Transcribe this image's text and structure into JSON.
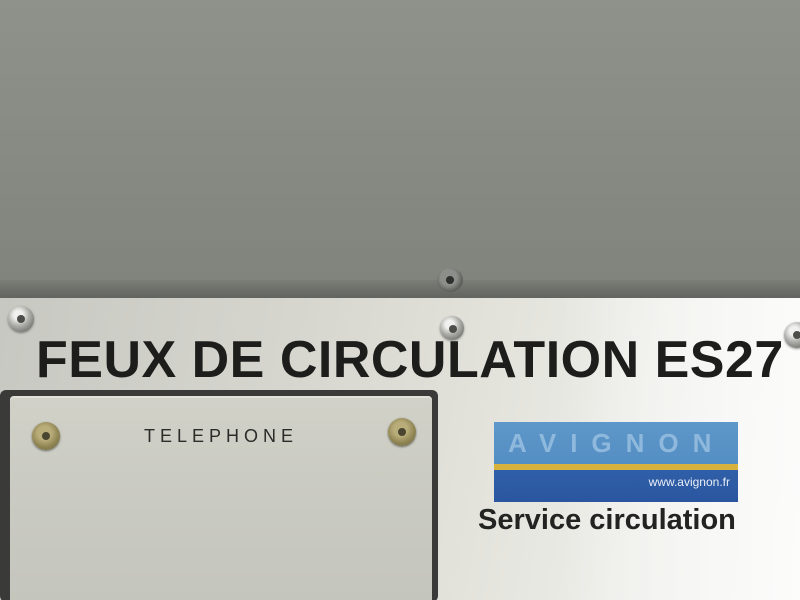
{
  "plate": {
    "title": "FEUX DE CIRCULATION ES27",
    "telephone_label": "TELEPHONE",
    "logo": {
      "name": "AVIGNON",
      "url": "www.avignon.fr"
    },
    "service_label": "Service circulation"
  },
  "colors": {
    "cabinet": "#878983",
    "plate": "#dcdcd5",
    "logo_blue": "#4a86bd",
    "logo_dark_blue": "#2a56a0",
    "logo_gold": "#d7b23c"
  }
}
